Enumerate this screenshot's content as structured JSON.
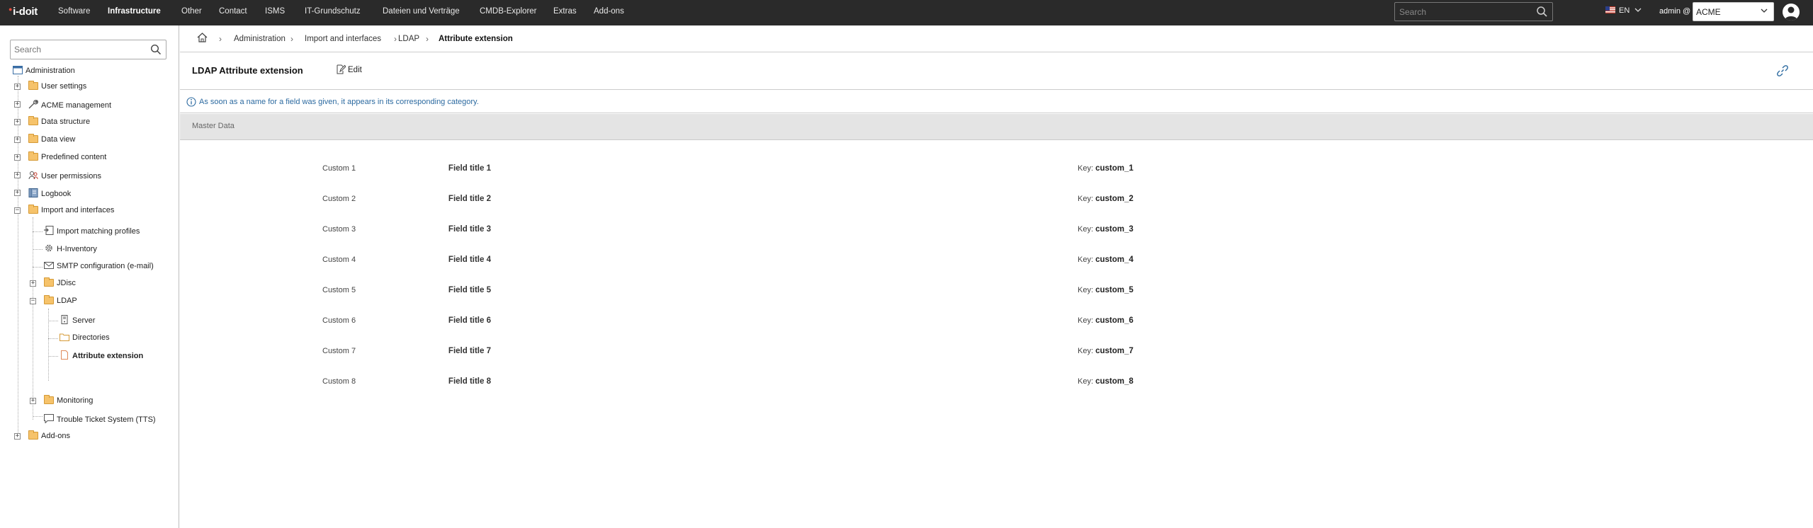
{
  "app": {
    "logo": "i-doit"
  },
  "topnav": {
    "items": [
      {
        "label": "Software"
      },
      {
        "label": "Infrastructure",
        "active": true
      },
      {
        "label": "Other"
      },
      {
        "label": "Contact"
      },
      {
        "label": "ISMS"
      },
      {
        "label": "IT-Grundschutz"
      },
      {
        "label": "Dateien und Verträge"
      },
      {
        "label": "CMDB-Explorer"
      },
      {
        "label": "Extras"
      },
      {
        "label": "Add-ons"
      }
    ],
    "search_placeholder": "Search",
    "language": "EN",
    "user_label": "admin @",
    "tenant": "ACME"
  },
  "sidebar": {
    "search_placeholder": "Search",
    "tree": {
      "root": "Administration",
      "items": [
        {
          "label": "User settings",
          "icon": "folder-icon"
        },
        {
          "label": "ACME management",
          "icon": "wrench-icon"
        },
        {
          "label": "Data structure",
          "icon": "folder-icon"
        },
        {
          "label": "Data view",
          "icon": "folder-icon"
        },
        {
          "label": "Predefined content",
          "icon": "folder-icon"
        },
        {
          "label": "User permissions",
          "icon": "users-icon"
        },
        {
          "label": "Logbook",
          "icon": "logbook-icon"
        },
        {
          "label": "Import and interfaces",
          "icon": "folder-open-icon",
          "expanded": true,
          "children": [
            {
              "label": "Import matching profiles",
              "icon": "import-icon"
            },
            {
              "label": "H-Inventory",
              "icon": "gear-icon"
            },
            {
              "label": "SMTP configuration (e-mail)",
              "icon": "mail-icon"
            },
            {
              "label": "JDisc",
              "icon": "folder-icon"
            },
            {
              "label": "LDAP",
              "icon": "folder-open-icon",
              "expanded": true,
              "children": [
                {
                  "label": "Server",
                  "icon": "server-icon"
                },
                {
                  "label": "Directories",
                  "icon": "folder-icon"
                },
                {
                  "label": "Attribute extension",
                  "icon": "page-icon",
                  "current": true
                }
              ]
            },
            {
              "label": "Monitoring",
              "icon": "folder-icon"
            },
            {
              "label": "Trouble Ticket System (TTS)",
              "icon": "ticket-icon"
            }
          ]
        },
        {
          "label": "Add-ons",
          "icon": "folder-icon"
        }
      ]
    }
  },
  "breadcrumb": [
    "Administration",
    "Import and interfaces",
    "LDAP",
    "Attribute extension"
  ],
  "page": {
    "title": "LDAP Attribute extension",
    "edit_label": "Edit",
    "info": "As soon as a name for a field was given, it appears in its corresponding category.",
    "section_title": "Master Data",
    "key_prefix": "Key:",
    "fields": [
      {
        "label": "Field title 1",
        "value": "Custom 1",
        "key": "custom_1"
      },
      {
        "label": "Field title 2",
        "value": "Custom 2",
        "key": "custom_2"
      },
      {
        "label": "Field title 3",
        "value": "Custom 3",
        "key": "custom_3"
      },
      {
        "label": "Field title 4",
        "value": "Custom 4",
        "key": "custom_4"
      },
      {
        "label": "Field title 5",
        "value": "Custom 5",
        "key": "custom_5"
      },
      {
        "label": "Field title 6",
        "value": "Custom 6",
        "key": "custom_6"
      },
      {
        "label": "Field title 7",
        "value": "Custom 7",
        "key": "custom_7"
      },
      {
        "label": "Field title 8",
        "value": "Custom 8",
        "key": "custom_8"
      }
    ]
  },
  "colors": {
    "topbar": "#2a2a2a",
    "info_text": "#2c6aa0",
    "section_bg": "#e4e4e4",
    "folder": "#f6c36b"
  }
}
